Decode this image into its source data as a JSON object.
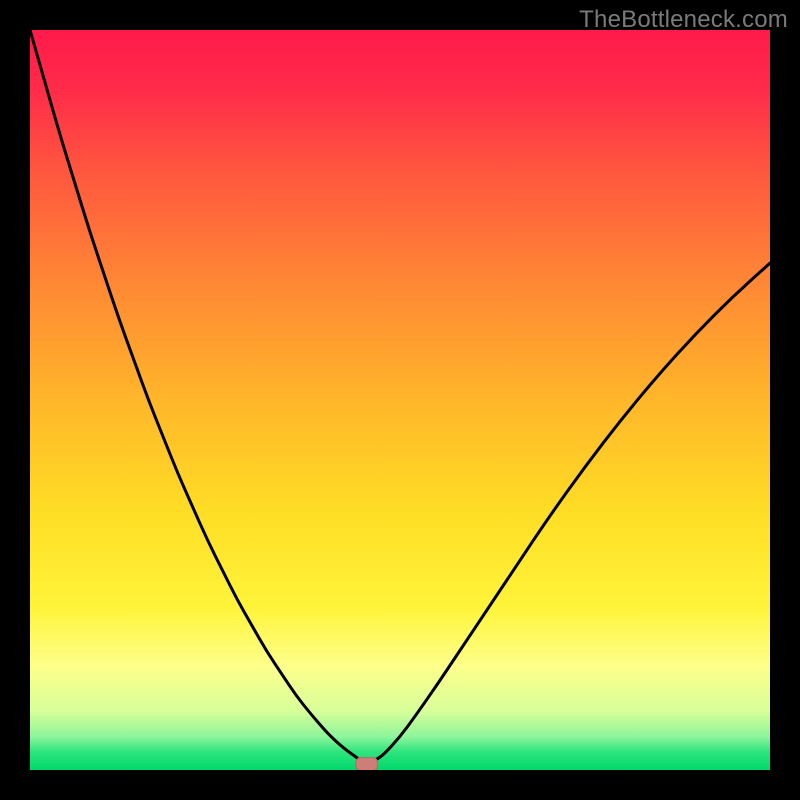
{
  "watermark": "TheBottleneck.com",
  "colors": {
    "frame": "#000000",
    "gradient_stops": [
      {
        "offset": 0.0,
        "color": "#ff1a4b"
      },
      {
        "offset": 0.08,
        "color": "#ff2b49"
      },
      {
        "offset": 0.2,
        "color": "#ff5a3e"
      },
      {
        "offset": 0.35,
        "color": "#ff8a34"
      },
      {
        "offset": 0.5,
        "color": "#ffb62a"
      },
      {
        "offset": 0.65,
        "color": "#ffdd25"
      },
      {
        "offset": 0.78,
        "color": "#fff43a"
      },
      {
        "offset": 0.86,
        "color": "#fdff8a"
      },
      {
        "offset": 0.92,
        "color": "#d8ff9a"
      },
      {
        "offset": 0.955,
        "color": "#8ef59a"
      },
      {
        "offset": 0.975,
        "color": "#2fe57f"
      },
      {
        "offset": 1.0,
        "color": "#00d96a"
      }
    ],
    "curve": "#000000",
    "marker_fill": "#cf7d79",
    "marker_stroke": "#b46863"
  },
  "chart_data": {
    "type": "line",
    "title": "",
    "xlabel": "",
    "ylabel": "",
    "xlim": [
      0,
      100
    ],
    "ylim": [
      0,
      100
    ],
    "x": [
      0,
      2,
      4,
      6,
      8,
      10,
      12,
      14,
      16,
      18,
      20,
      22,
      24,
      26,
      28,
      30,
      32,
      34,
      36,
      38,
      40,
      41,
      42,
      43,
      44,
      44.5,
      45,
      45.5,
      46,
      47,
      48,
      50,
      52,
      55,
      58,
      62,
      66,
      70,
      75,
      80,
      85,
      90,
      95,
      100
    ],
    "values": [
      100,
      93,
      86,
      79.5,
      73,
      67,
      61,
      55.5,
      50,
      45,
      40,
      35.5,
      31,
      27,
      23,
      19.5,
      16,
      13,
      10,
      7.5,
      5.2,
      4.2,
      3.3,
      2.5,
      1.8,
      1.4,
      1.1,
      1.0,
      1.1,
      1.5,
      2.3,
      4.5,
      7.2,
      11.5,
      16,
      22,
      28,
      34,
      41,
      47.5,
      53.5,
      59,
      64,
      68.5
    ],
    "trough_x": 45.5,
    "annotations": [
      {
        "type": "marker",
        "shape": "rounded-rect",
        "x": 45.5,
        "y": 0.8
      }
    ]
  }
}
